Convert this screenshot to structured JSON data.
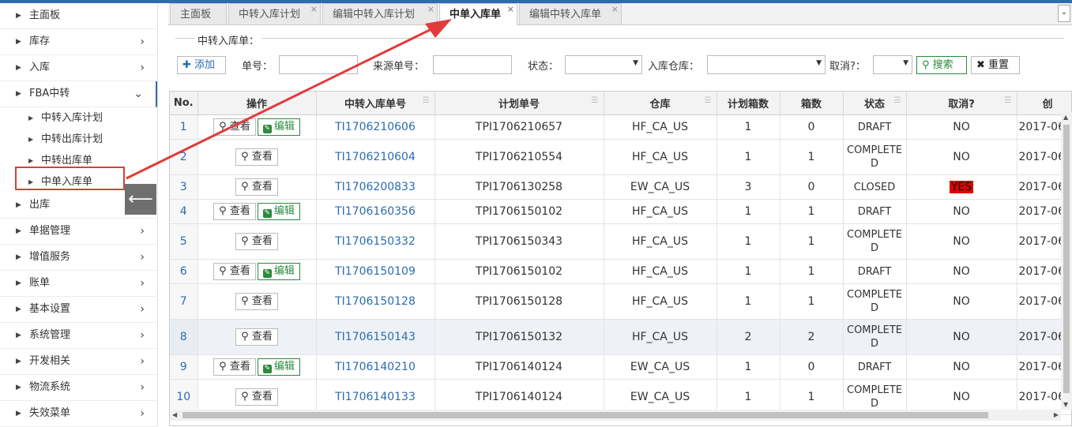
{
  "sidebar": {
    "items": [
      {
        "label": "主面板"
      },
      {
        "label": "库存"
      },
      {
        "label": "入库"
      },
      {
        "label": "FBA中转"
      },
      {
        "label": "出库"
      },
      {
        "label": "单据管理"
      },
      {
        "label": "增值服务"
      },
      {
        "label": "账单"
      },
      {
        "label": "基本设置"
      },
      {
        "label": "系统管理"
      },
      {
        "label": "开发相关"
      },
      {
        "label": "物流系统"
      },
      {
        "label": "失效菜单"
      }
    ],
    "fba_sub": [
      {
        "label": "中转入库计划"
      },
      {
        "label": "中转出库计划"
      },
      {
        "label": "中转出库单"
      },
      {
        "label": "中单入库单"
      }
    ],
    "collapse_icon": "arrow-left-icon"
  },
  "tabs": [
    {
      "label": "主面板"
    },
    {
      "label": "中转入库计划"
    },
    {
      "label": "编辑中转入库计划"
    },
    {
      "label": "中单入库单"
    },
    {
      "label": "编辑中转入库单"
    }
  ],
  "search": {
    "legend": "中转入库单：",
    "add_label": "添加",
    "order_no_label": "单号：",
    "source_no_label": "来源单号：",
    "status_label": "状态：",
    "warehouse_label": "入库仓库：",
    "cancel_label": "取消?：",
    "search_label": "搜索",
    "reset_label": "重置"
  },
  "table": {
    "headers": [
      "No.",
      "操作",
      "中转入库单号",
      "计划单号",
      "仓库",
      "计划箱数",
      "箱数",
      "状态",
      "取消?",
      "创"
    ],
    "view_label": "查看",
    "edit_label": "编辑",
    "rows": [
      {
        "no": "1",
        "editable": true,
        "id": "TI1706210606",
        "plan": "TPI1706210657",
        "wh": "HF_CA_US",
        "plan_boxes": "1",
        "boxes": "0",
        "status": "DRAFT",
        "cancel": "NO",
        "created": "2017-06"
      },
      {
        "no": "2",
        "editable": false,
        "id": "TI1706210604",
        "plan": "TPI1706210554",
        "wh": "HF_CA_US",
        "plan_boxes": "1",
        "boxes": "1",
        "status": "COMPLETED",
        "cancel": "NO",
        "created": "2017-06"
      },
      {
        "no": "3",
        "editable": false,
        "id": "TI1706200833",
        "plan": "TPI1706130258",
        "wh": "EW_CA_US",
        "plan_boxes": "3",
        "boxes": "0",
        "status": "CLOSED",
        "cancel": "YES",
        "created": "2017-06"
      },
      {
        "no": "4",
        "editable": true,
        "id": "TI1706160356",
        "plan": "TPI1706150102",
        "wh": "HF_CA_US",
        "plan_boxes": "1",
        "boxes": "1",
        "status": "DRAFT",
        "cancel": "NO",
        "created": "2017-06"
      },
      {
        "no": "5",
        "editable": false,
        "id": "TI1706150332",
        "plan": "TPI1706150343",
        "wh": "HF_CA_US",
        "plan_boxes": "1",
        "boxes": "1",
        "status": "COMPLETED",
        "cancel": "NO",
        "created": "2017-06"
      },
      {
        "no": "6",
        "editable": true,
        "id": "TI1706150109",
        "plan": "TPI1706150102",
        "wh": "HF_CA_US",
        "plan_boxes": "1",
        "boxes": "1",
        "status": "DRAFT",
        "cancel": "NO",
        "created": "2017-06"
      },
      {
        "no": "7",
        "editable": false,
        "id": "TI1706150128",
        "plan": "TPI1706150128",
        "wh": "HF_CA_US",
        "plan_boxes": "1",
        "boxes": "1",
        "status": "COMPLETED",
        "cancel": "NO",
        "created": "2017-06"
      },
      {
        "no": "8",
        "editable": false,
        "id": "TI1706150143",
        "plan": "TPI1706150132",
        "wh": "HF_CA_US",
        "plan_boxes": "2",
        "boxes": "2",
        "status": "COMPLETED",
        "cancel": "NO",
        "created": "2017-06"
      },
      {
        "no": "9",
        "editable": true,
        "id": "TI1706140210",
        "plan": "TPI1706140124",
        "wh": "EW_CA_US",
        "plan_boxes": "1",
        "boxes": "0",
        "status": "DRAFT",
        "cancel": "NO",
        "created": "2017-06"
      },
      {
        "no": "10",
        "editable": false,
        "id": "TI1706140133",
        "plan": "TPI1706140124",
        "wh": "EW_CA_US",
        "plan_boxes": "1",
        "boxes": "1",
        "status": "COMPLETED",
        "cancel": "NO",
        "created": "2017-06"
      }
    ]
  },
  "colors": {
    "accent": "#2b6cb0",
    "annotation": "#e23b3b",
    "cancel_yes": "#e00000",
    "edit_green": "#2b8a3e"
  }
}
